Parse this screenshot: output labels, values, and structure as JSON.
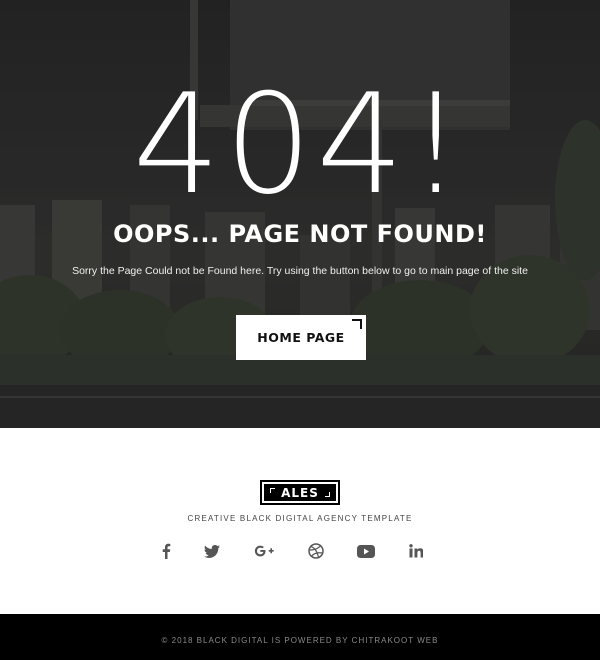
{
  "hero": {
    "code": "404!",
    "title": "OOPS... PAGE NOT FOUND!",
    "message": "Sorry the Page Could not be Found here. Try using the button below to go to main page of the site",
    "button_label": "HOME PAGE"
  },
  "footer": {
    "logo_text": "ALES",
    "tagline": "CREATIVE BLACK DIGITAL AGENCY TEMPLATE",
    "socials": [
      "facebook-icon",
      "twitter-icon",
      "google-plus-icon",
      "dribbble-icon",
      "youtube-icon",
      "linkedin-icon"
    ],
    "copyright": "© 2018 BLACK DIGITAL IS POWERED BY CHITRAKOOT WEB"
  },
  "colors": {
    "icon": "#555555",
    "bottom_bar": "#000000"
  }
}
